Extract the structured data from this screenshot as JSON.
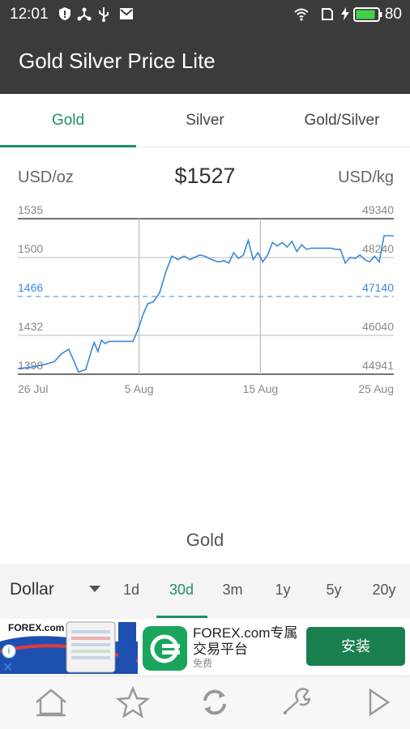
{
  "status_bar": {
    "time": "12:01",
    "battery_percent": "80",
    "icons": [
      "shield-icon",
      "usb-tether-icon",
      "usb-icon",
      "mail-icon",
      "wifi-icon",
      "sim-icon",
      "charging-icon",
      "battery-icon"
    ]
  },
  "app": {
    "title": "Gold Silver Price Lite"
  },
  "tabs": [
    {
      "label": "Gold",
      "active": true
    },
    {
      "label": "Silver",
      "active": false
    },
    {
      "label": "Gold/Silver",
      "active": false
    }
  ],
  "chart_header": {
    "unit_left": "USD/oz",
    "price": "$1527",
    "unit_right": "USD/kg"
  },
  "chart_data": {
    "type": "line",
    "left_ticks": [
      "1535",
      "1500",
      "1466",
      "1432",
      "1398"
    ],
    "right_ticks": [
      "49340",
      "48240",
      "47140",
      "46040",
      "44941"
    ],
    "x_ticks": [
      "26 Jul",
      "5 Aug",
      "15 Aug",
      "25 Aug"
    ],
    "ylim": [
      1398,
      1535
    ],
    "xlim": [
      0,
      31
    ],
    "highlight_level": 1466,
    "line_color": "#3b88d8",
    "x": [
      0,
      1,
      2,
      3,
      3.6,
      4.2,
      4.6,
      5,
      5.6,
      6.1,
      6.3,
      6.6,
      6.9,
      7.2,
      7.5,
      7.8,
      8.1,
      8.5,
      9,
      9.5,
      10,
      10.3,
      10.7,
      11.2,
      11.7,
      12.2,
      12.7,
      13.2,
      13.7,
      14.2,
      14.6,
      15,
      15.4,
      15.8,
      16.2,
      16.6,
      17,
      17.4,
      17.8,
      18.2,
      18.6,
      19.0,
      19.4,
      19.8,
      20.2,
      20.6,
      21.0,
      21.4,
      21.8,
      22.2,
      22.6,
      23.0,
      23.4,
      23.8,
      24.2,
      24.6,
      25.0,
      25.4,
      25.8,
      26.2,
      26.6,
      27.0,
      27.4,
      27.8,
      28.2,
      28.6,
      29.0,
      29.4,
      29.8,
      30.2,
      30.6,
      31
    ],
    "y": [
      1403,
      1404,
      1406,
      1409,
      1416,
      1420,
      1410,
      1400,
      1402,
      1420,
      1426,
      1418,
      1428,
      1425,
      1427,
      1427,
      1427,
      1427,
      1427,
      1427,
      1440,
      1450,
      1460,
      1462,
      1470,
      1488,
      1502,
      1499,
      1502,
      1499,
      1501,
      1503,
      1502,
      1500,
      1498,
      1497,
      1498,
      1496,
      1505,
      1500,
      1503,
      1516,
      1499,
      1505,
      1497,
      1503,
      1514,
      1511,
      1514,
      1510,
      1515,
      1506,
      1512,
      1508,
      1509,
      1509,
      1509,
      1509,
      1509,
      1508,
      1508,
      1496,
      1501,
      1500,
      1503,
      1499,
      1497,
      1502,
      1497,
      1520,
      1520,
      1520
    ]
  },
  "metal_label": "Gold",
  "range_bar": {
    "currency": "Dollar",
    "ranges": [
      {
        "label": "1d",
        "active": false
      },
      {
        "label": "30d",
        "active": true
      },
      {
        "label": "3m",
        "active": false
      },
      {
        "label": "1y",
        "active": false
      },
      {
        "label": "5y",
        "active": false
      },
      {
        "label": "20y",
        "active": false
      }
    ]
  },
  "ad": {
    "brand": "FOREX.com",
    "title_line1": "FOREX.com专属",
    "title_line2": "交易平台",
    "subtitle": "免费",
    "install_label": "安装",
    "info_glyph": "i",
    "close_glyph": "✕"
  },
  "bottom_nav": [
    "home-icon",
    "star-icon",
    "refresh-icon",
    "wrench-icon",
    "play-icon"
  ],
  "colors": {
    "accent": "#1f8f68",
    "bar": "#3b3b3b",
    "line": "#3b88d8",
    "install": "#1a7f4f"
  }
}
